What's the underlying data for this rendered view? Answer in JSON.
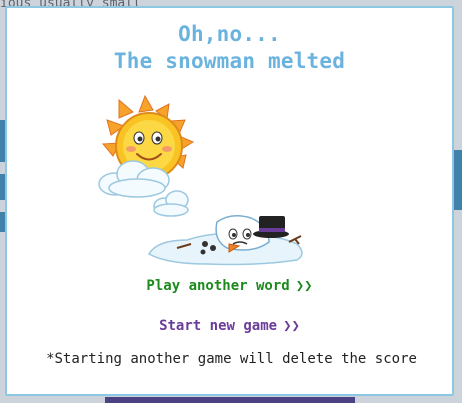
{
  "background": {
    "partial_text": "ious usually small"
  },
  "modal": {
    "title_line1": "Oh,no...",
    "title_line2": "The snowman melted",
    "play_label": "Play another word",
    "play_icon": "double-chevron-right-icon",
    "start_label": "Start new game",
    "start_icon": "double-chevron-right-icon",
    "note": "*Starting another game will delete the score",
    "colors": {
      "title": "#6bb3df",
      "play": "#1c8a1c",
      "start": "#6a3c9a",
      "border": "#8cc7e4"
    }
  }
}
